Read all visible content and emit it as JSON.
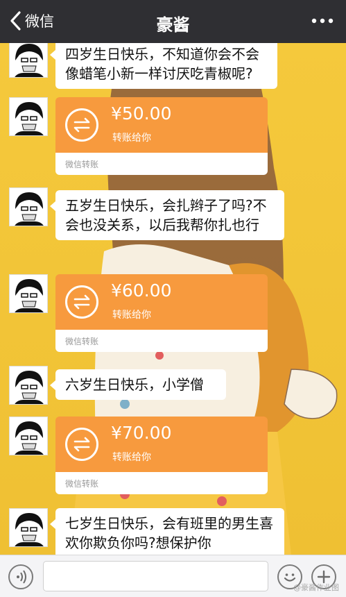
{
  "navbar": {
    "back_label": "微信",
    "title": "豪酱",
    "back_icon": "chevron-left-icon",
    "more_icon": "more-dots-icon",
    "background": "#2f2f33"
  },
  "messages": {
    "m1": {
      "text": "四岁生日快乐，不知道你会不会像蜡笔小新一样讨厌吃青椒呢?"
    },
    "t1": {
      "amount": "¥50.00",
      "subtitle": "转账给你",
      "app": "微信转账"
    },
    "m2": {
      "text": "五岁生日快乐，会扎辫子了吗?不会也没关系，以后我帮你扎也行"
    },
    "t2": {
      "amount": "¥60.00",
      "subtitle": "转账给你",
      "app": "微信转账"
    },
    "m3": {
      "text": "六岁生日快乐，小学僧"
    },
    "t3": {
      "amount": "¥70.00",
      "subtitle": "转账给你",
      "app": "微信转账"
    },
    "m4": {
      "text": "七岁生日快乐，会有班里的男生喜欢你欺负你吗?想保护你"
    }
  },
  "colors": {
    "chat_background": "#f0c53a",
    "transfer_orange": "#f79a3e",
    "bubble": "#ffffff"
  },
  "inputbar": {
    "voice_icon": "voice-icon",
    "emoji_icon": "emoji-icon",
    "plus_icon": "plus-icon",
    "watermark": "@豪酱作业图"
  }
}
